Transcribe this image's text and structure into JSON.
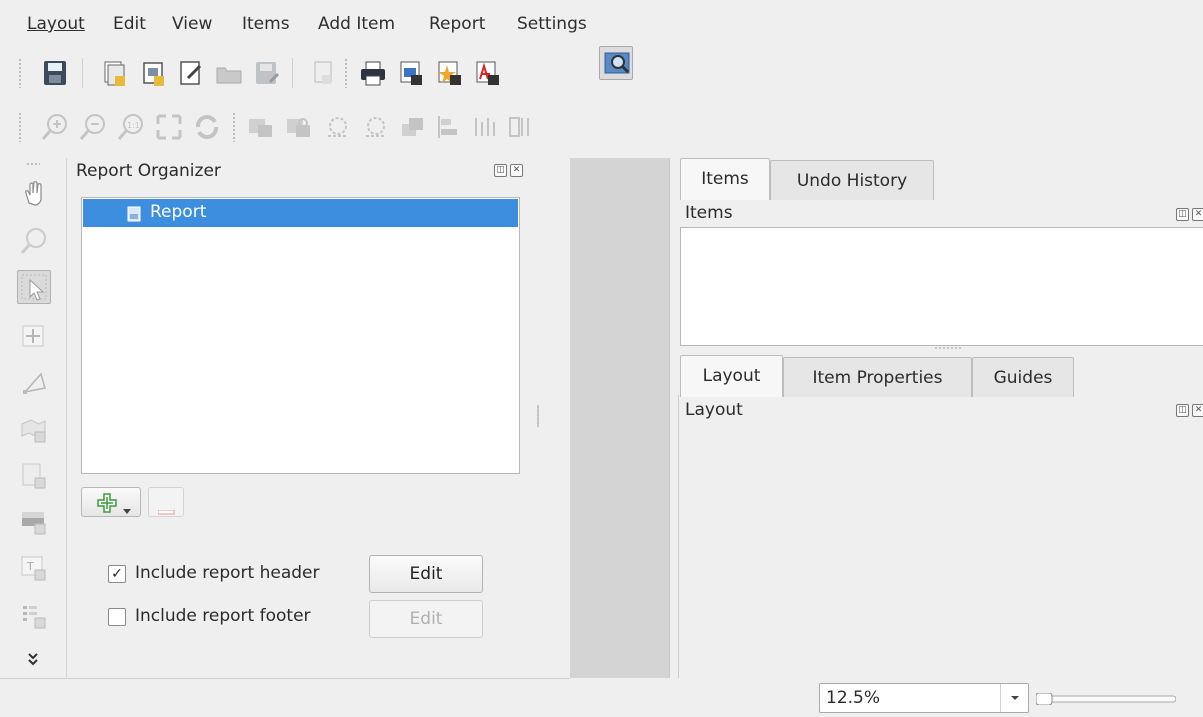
{
  "menu": {
    "layout": "Layout",
    "edit": "Edit",
    "view": "View",
    "items": "Items",
    "add_item": "Add Item",
    "report": "Report",
    "settings": "Settings"
  },
  "report_organizer": {
    "title": "Report Organizer",
    "tree": [
      {
        "label": "Report",
        "selected": true
      }
    ],
    "include_header_label": "Include report header",
    "include_header_checked": true,
    "include_header_edit": "Edit",
    "include_footer_label": "Include report footer",
    "include_footer_checked": false,
    "include_footer_edit": "Edit"
  },
  "items_dock": {
    "tabs": [
      "Items",
      "Undo History"
    ],
    "active_tab": "Items",
    "title": "Items"
  },
  "layout_dock": {
    "tabs": [
      "Layout",
      "Item Properties",
      "Guides"
    ],
    "active_tab": "Layout",
    "title": "Layout"
  },
  "status": {
    "zoom": "12.5%"
  },
  "colors": {
    "selection": "#3d8ede",
    "canvas": "#d4d4d4",
    "add_green": "#3a9a3a"
  }
}
